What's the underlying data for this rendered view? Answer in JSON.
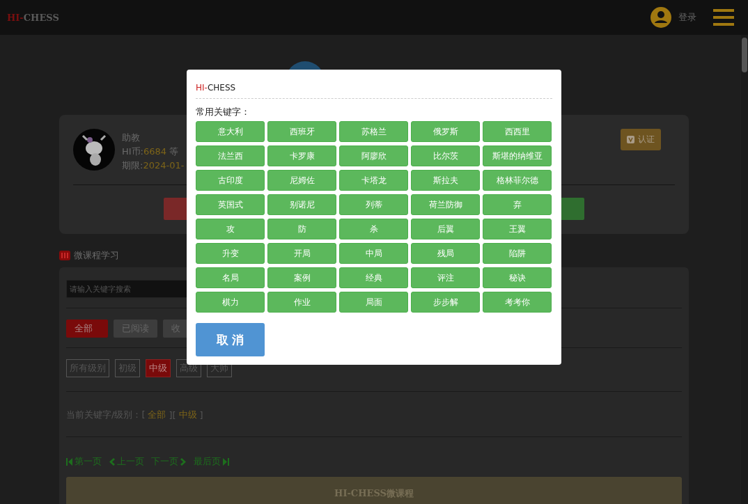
{
  "header": {
    "logo_prefix": "HI-",
    "logo_rest": "CHESS",
    "login": "登录"
  },
  "profile": {
    "name": "助教",
    "coins_label": "HI币:",
    "coins": "6684",
    "level_label": "等",
    "expiry_label": "期限:",
    "expiry": "2024-01-",
    "certify": "认证"
  },
  "section_title": "微课程学习",
  "search": {
    "placeholder": "请输入关键字搜索"
  },
  "tabs": [
    {
      "label": "全部",
      "selected": true
    },
    {
      "label": "已阅读",
      "selected": false
    },
    {
      "label": "收",
      "selected": false
    }
  ],
  "levels": [
    {
      "label": "所有级别",
      "selected": false
    },
    {
      "label": "初级",
      "selected": false
    },
    {
      "label": "中级",
      "selected": true
    },
    {
      "label": "高级",
      "selected": false
    },
    {
      "label": "大师",
      "selected": false
    }
  ],
  "current_filter": {
    "label": "当前关键字/级别：[",
    "keyword": "全部",
    "middle": "][",
    "level": "中级",
    "end": "]"
  },
  "pagination": {
    "first": "第一页",
    "prev": "上一页",
    "next": "下一页",
    "last": "最后页"
  },
  "course_banner": "HI-CHESS微课程",
  "dialog": {
    "title_prefix": "HI-",
    "title_rest": "CHESS",
    "keywords_label": "常用关键字：",
    "keywords": [
      "意大利",
      "西班牙",
      "苏格兰",
      "俄罗斯",
      "西西里",
      "法兰西",
      "卡罗康",
      "阿廖欣",
      "比尔茨",
      "斯堪的纳维亚",
      "古印度",
      "尼姆佐",
      "卡塔龙",
      "斯拉夫",
      "格林菲尔德",
      "英国式",
      "别诺尼",
      "列蒂",
      "荷兰防御",
      "弃",
      "攻",
      "防",
      "杀",
      "后翼",
      "王翼",
      "升变",
      "开局",
      "中局",
      "残局",
      "陷阱",
      "名局",
      "案例",
      "经典",
      "评注",
      "秘诀",
      "棋力",
      "作业",
      "局面",
      "步步解",
      "考考你"
    ],
    "cancel": "取 消"
  }
}
